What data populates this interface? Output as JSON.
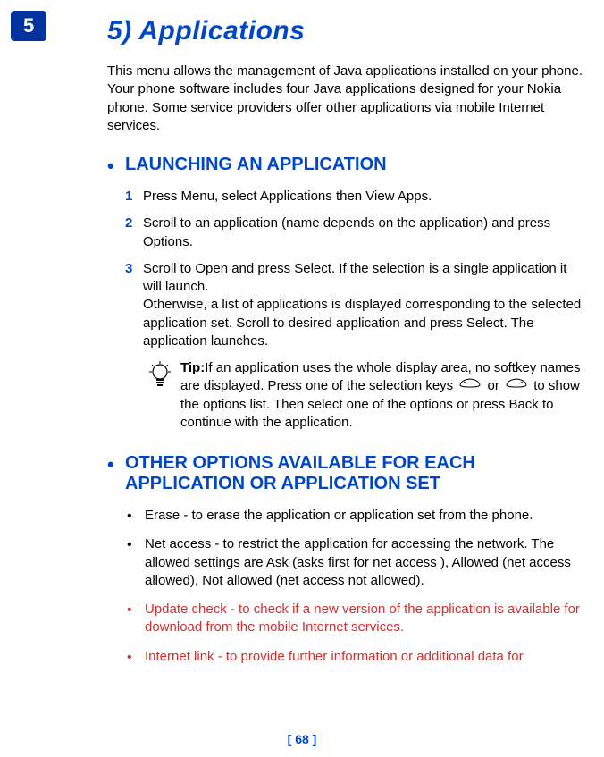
{
  "page_tab": "5",
  "title": "5) Applications",
  "intro": "This menu allows the management of Java applications installed on your phone. Your phone software includes four Java applications designed for your Nokia phone. Some service providers offer other applications via mobile Internet services.",
  "section1": {
    "heading": "LAUNCHING AN APPLICATION",
    "steps": [
      {
        "num": "1",
        "text": "Press Menu,  select Applications then View Apps."
      },
      {
        "num": "2",
        "text": "Scroll to an application (name depends on the application) and press Options."
      },
      {
        "num": "3",
        "text": "Scroll to Open and press Select. If the selection is a single application it will launch.\nOtherwise, a list of applications is displayed corresponding to the selected application set. Scroll to desired application and press Select. The application launches."
      }
    ],
    "tip": {
      "label": "Tip:",
      "before_keys": "If an application uses the whole display area, no softkey names are displayed. Press one of the selection keys ",
      "between_keys": " or ",
      "after_keys": " to show the options list. Then select one of the options or press Back to continue with the application."
    }
  },
  "section2": {
    "heading": "OTHER OPTIONS AVAILABLE FOR EACH APPLICATION OR APPLICATION SET",
    "bullets": [
      {
        "style": "black",
        "text": "Erase - to erase the application or application set from the phone."
      },
      {
        "style": "black",
        "text": "Net access - to restrict the application for accessing the network. The allowed settings are Ask (asks first for net access ), Allowed (net access allowed), Not allowed (net access not allowed)."
      },
      {
        "style": "red",
        "text": "Update check - to check if a new version of the application is available for download from the mobile Internet services."
      },
      {
        "style": "red",
        "text": "Internet link - to provide further information or additional data for"
      }
    ]
  },
  "page_number": "[ 68 ]"
}
